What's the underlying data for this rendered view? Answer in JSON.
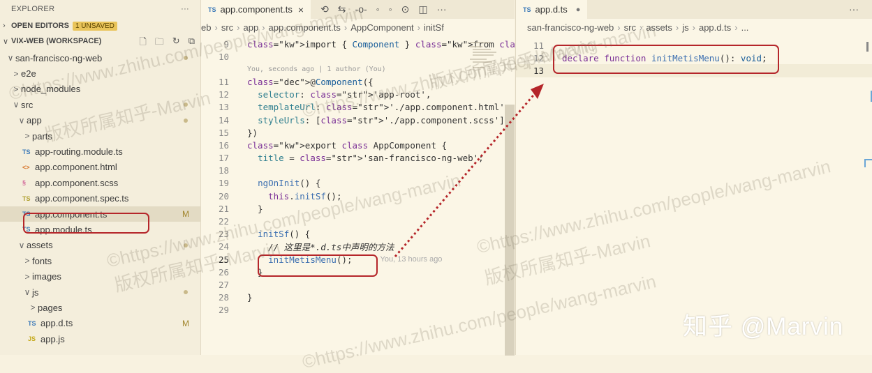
{
  "explorer": {
    "title": "EXPLORER",
    "more": "···",
    "open_editors": {
      "label": "OPEN EDITORS",
      "badge": "1 UNSAVED"
    },
    "workspace": {
      "label": "VIX-WEB (WORKSPACE)"
    },
    "tree": [
      {
        "label": "san-francisco-ng-web",
        "chev": "∨",
        "depth": 0,
        "dot": true
      },
      {
        "label": "e2e",
        "chev": ">",
        "depth": 1
      },
      {
        "label": "node_modules",
        "chev": ">",
        "depth": 1
      },
      {
        "label": "src",
        "chev": "∨",
        "depth": 1,
        "dot": true
      },
      {
        "label": "app",
        "chev": "∨",
        "depth": 2,
        "dot": true
      },
      {
        "label": "parts",
        "chev": ">",
        "depth": 3
      },
      {
        "label": "app-routing.module.ts",
        "icon": "TS",
        "depth": 3
      },
      {
        "label": "app.component.html",
        "icon": "<>",
        "depth": 3
      },
      {
        "label": "app.component.scss",
        "icon": "§",
        "depth": 3
      },
      {
        "label": "app.component.spec.ts",
        "icon": "TS",
        "depth": 3
      },
      {
        "label": "app.component.ts",
        "icon": "TS",
        "depth": 3,
        "selected": true,
        "flag": "M"
      },
      {
        "label": "app.module.ts",
        "icon": "TS",
        "depth": 3
      },
      {
        "label": "assets",
        "chev": "∨",
        "depth": 2,
        "dot": true
      },
      {
        "label": "fonts",
        "chev": ">",
        "depth": 3
      },
      {
        "label": "images",
        "chev": ">",
        "depth": 3
      },
      {
        "label": "js",
        "chev": "∨",
        "depth": 3,
        "dot": true
      },
      {
        "label": "pages",
        "chev": ">",
        "depth": 4
      },
      {
        "label": "app.d.ts",
        "icon": "TS",
        "depth": 4,
        "flag": "M"
      },
      {
        "label": "app.js",
        "icon": "JS",
        "depth": 4
      }
    ]
  },
  "left_editor": {
    "tab": {
      "ts": "TS",
      "label": "app.component.ts",
      "close": "×"
    },
    "breadcrumb": [
      "eb",
      "src",
      "app",
      "app.component.ts",
      "AppComponent",
      "initSf"
    ],
    "blame_inline": "You, seconds ago | 1 author (You)",
    "blame_line25": "You, 13 hours ago",
    "lines": [
      {
        "n": "9",
        "code": "import { Component } from '@angular/core';"
      },
      {
        "n": "10",
        "code": ""
      },
      {
        "n": "11",
        "code": "@Component({"
      },
      {
        "n": "12",
        "code": "  selector: 'app-root',"
      },
      {
        "n": "13",
        "code": "  templateUrl: './app.component.html',"
      },
      {
        "n": "14",
        "code": "  styleUrls: ['./app.component.scss']"
      },
      {
        "n": "15",
        "code": "})"
      },
      {
        "n": "16",
        "code": "export class AppComponent {"
      },
      {
        "n": "17",
        "code": "  title = 'san-francisco-ng-web';"
      },
      {
        "n": "18",
        "code": ""
      },
      {
        "n": "19",
        "code": "  ngOnInit() {"
      },
      {
        "n": "20",
        "code": "    this.initSf();"
      },
      {
        "n": "21",
        "code": "  }"
      },
      {
        "n": "22",
        "code": ""
      },
      {
        "n": "23",
        "code": "  initSf() {"
      },
      {
        "n": "24",
        "code": "    // 这里是*.d.ts中声明的方法"
      },
      {
        "n": "25",
        "code": "    initMetisMenu();"
      },
      {
        "n": "26",
        "code": "  }"
      },
      {
        "n": "27",
        "code": ""
      },
      {
        "n": "28",
        "code": "}"
      },
      {
        "n": "29",
        "code": ""
      }
    ]
  },
  "right_editor": {
    "tab": {
      "ts": "TS",
      "label": "app.d.ts",
      "unsaved_dot": "●"
    },
    "more": "···",
    "breadcrumb": [
      "san-francisco-ng-web",
      "src",
      "assets",
      "js",
      "app.d.ts",
      "..."
    ],
    "lines": [
      {
        "n": "11",
        "code": ""
      },
      {
        "n": "12",
        "code": "declare function initMetisMenu(): void;"
      },
      {
        "n": "13",
        "code": ""
      }
    ]
  },
  "watermark": {
    "url": "©https://www.zhihu.com/people/wang-marvin",
    "url_short": "©https://www.zhihu.com/people/wang-marvin",
    "owner": "版权所属知乎-Marvin",
    "brand": "知乎 @Marvin"
  },
  "colors": {
    "annotation": "#b5262a",
    "background": "#f8f2e0"
  }
}
